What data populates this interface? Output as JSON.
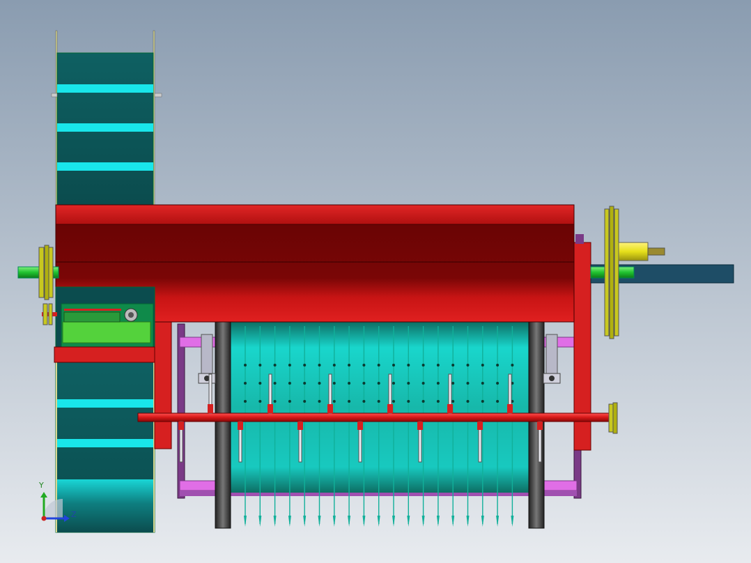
{
  "viewport": {
    "background_top": "#8a9cb0",
    "background_bottom": "#e8ebef"
  },
  "colors": {
    "frame_red": "#d62020",
    "frame_dark_red": "#7a0606",
    "belt_teal": "#0b4c4e",
    "belt_cyan": "#19e6ea",
    "drum_light": "#18c9bf",
    "drum_dark": "#0d6e63",
    "spike": "#11b09a",
    "shaft_green": "#1fc12f",
    "pulley_yellow": "#c8c820",
    "bearing_yellow": "#e6e01a",
    "blue_shaft": "#1e4d66",
    "rail_pink": "#e06ee6",
    "rail_purple": "#7a3a86",
    "wheel_dark": "#3c3c3c",
    "gray_bracket": "#b8b8c8",
    "gear_green": "#54d23c"
  },
  "triad": {
    "y_label": "Y",
    "z_label": "Z",
    "y_color": "#22aa22",
    "z_color": "#2244dd",
    "x_color": "#cc2222"
  }
}
